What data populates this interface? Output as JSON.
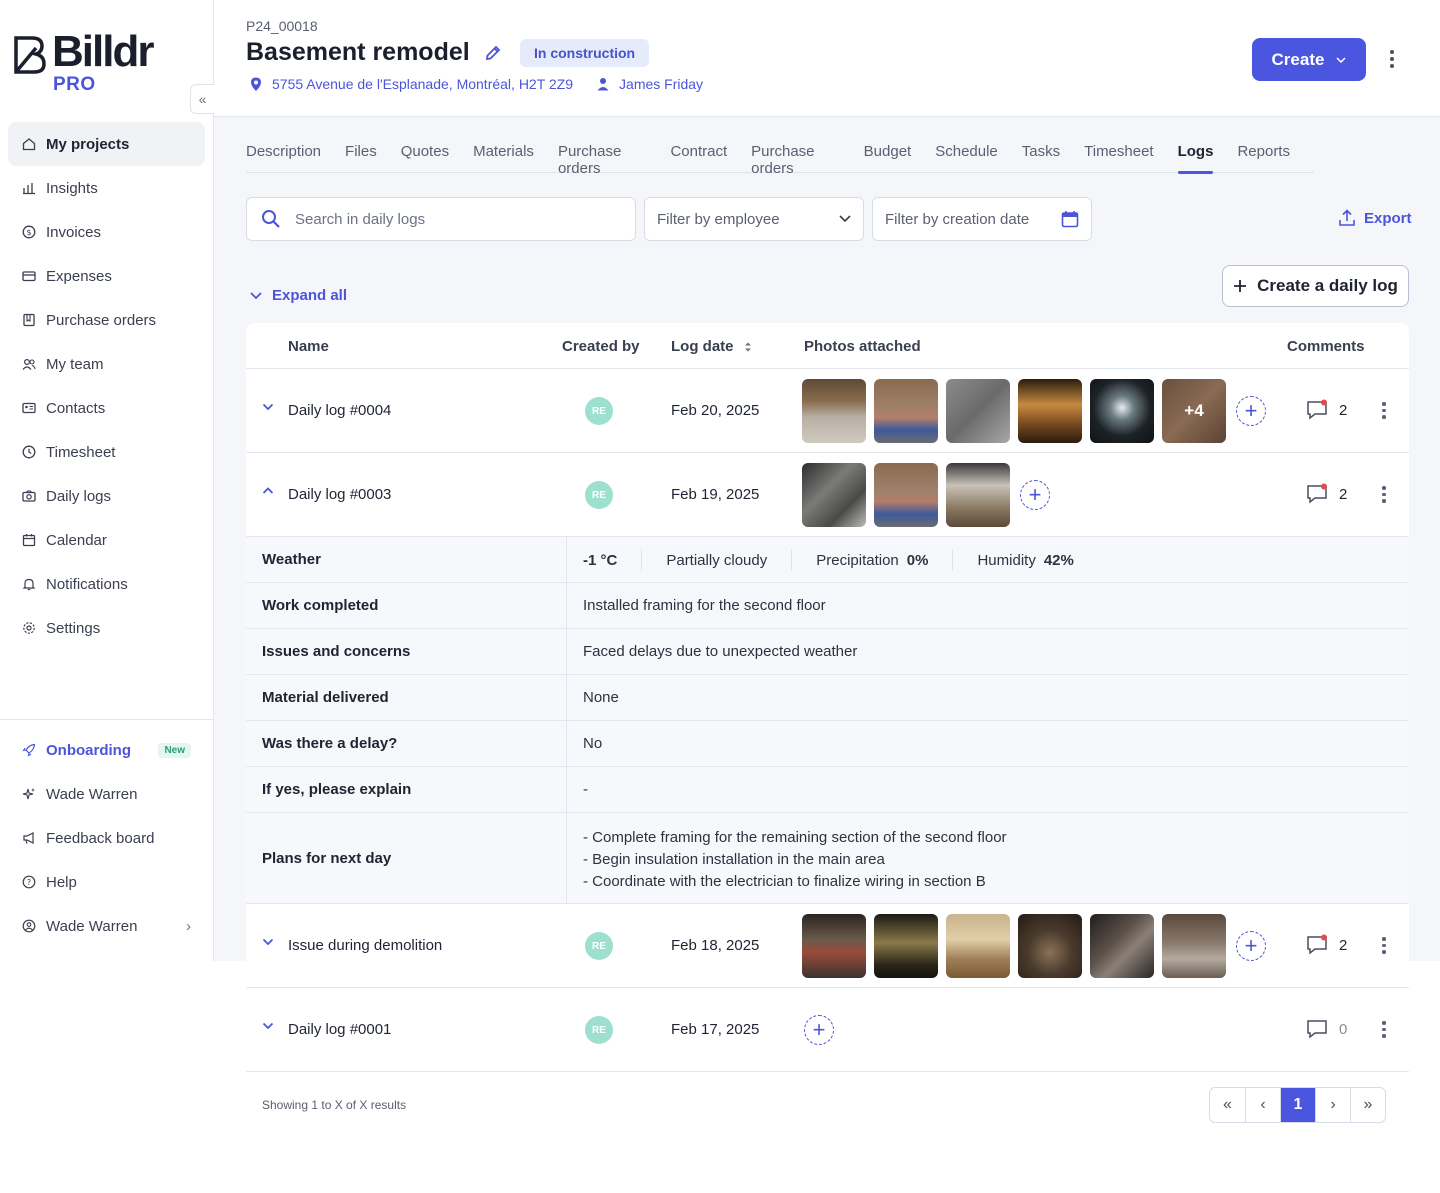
{
  "sidebar": {
    "logo_text": "Billdr",
    "logo_sub": "PRO",
    "items": [
      {
        "label": "My projects",
        "icon": "home-icon"
      },
      {
        "label": "Insights",
        "icon": "chart-icon"
      },
      {
        "label": "Invoices",
        "icon": "dollar-icon"
      },
      {
        "label": "Expenses",
        "icon": "card-icon"
      },
      {
        "label": "Purchase orders",
        "icon": "book-icon"
      },
      {
        "label": "My team",
        "icon": "team-icon"
      },
      {
        "label": "Contacts",
        "icon": "contacts-icon"
      },
      {
        "label": "Timesheet",
        "icon": "clock-icon"
      },
      {
        "label": "Daily logs",
        "icon": "camera-icon"
      },
      {
        "label": "Calendar",
        "icon": "calendar-icon"
      },
      {
        "label": "Notifications",
        "icon": "bell-icon"
      },
      {
        "label": "Settings",
        "icon": "gear-icon"
      }
    ],
    "bottom": {
      "onboarding": "Onboarding",
      "onboarding_badge": "New",
      "assistant": "Wade Warren",
      "feedback": "Feedback board",
      "help": "Help",
      "user": "Wade Warren"
    }
  },
  "header": {
    "code": "P24_00018",
    "title": "Basement remodel",
    "status": "In construction",
    "address": "5755 Avenue de l'Esplanade, Montréal, H2T 2Z9",
    "person": "James Friday",
    "create_label": "Create"
  },
  "tabs": [
    "Description",
    "Files",
    "Quotes",
    "Materials",
    "Purchase orders",
    "Contract",
    "Purchase orders",
    "Budget",
    "Schedule",
    "Tasks",
    "Timesheet",
    "Logs",
    "Reports"
  ],
  "active_tab": "Logs",
  "toolbar": {
    "search_placeholder": "Search in daily logs",
    "filter_employee": "Filter by employee",
    "filter_date": "Filter by creation date",
    "export": "Export",
    "expand_all": "Expand all",
    "create_log": "Create a daily log"
  },
  "table": {
    "headers": {
      "name": "Name",
      "created_by": "Created by",
      "log_date": "Log date",
      "photos": "Photos attached",
      "comments": "Comments"
    },
    "rows": [
      {
        "name": "Daily log #0004",
        "creator": "RE",
        "date": "Feb 20, 2025",
        "more_photos": "+4",
        "comments": "2"
      },
      {
        "name": "Daily log #0003",
        "creator": "RE",
        "date": "Feb 19, 2025",
        "comments": "2"
      },
      {
        "name": "Issue during demolition",
        "creator": "RE",
        "date": "Feb 18, 2025",
        "comments": "2"
      },
      {
        "name": "Daily log #0001",
        "creator": "RE",
        "date": "Feb 17, 2025",
        "comments": "0"
      }
    ],
    "detail": {
      "weather_label": "Weather",
      "temp": "-1 °C",
      "sky": "Partially cloudy",
      "precip_label": "Precipitation",
      "precip": "0%",
      "humidity_label": "Humidity",
      "humidity": "42%",
      "work_label": "Work completed",
      "work": "Installed framing for the second floor",
      "issues_label": "Issues and concerns",
      "issues": "Faced delays due to unexpected weather",
      "material_label": "Material delivered",
      "material": "None",
      "delay_label": "Was there a delay?",
      "delay": "No",
      "explain_label": "If yes, please explain",
      "explain": "-",
      "plans_label": "Plans for next day",
      "plans": [
        "- Complete framing for the remaining section of the second floor",
        "- Begin insulation installation in the main area",
        "- Coordinate with the electrician to finalize wiring in section B"
      ]
    }
  },
  "pagination": {
    "summary": "Showing 1 to X of X results",
    "current": "1"
  },
  "colors": {
    "accent": "#4a55e0",
    "avatar": "#9ee0cf",
    "comment_dot": "#e5484d"
  }
}
